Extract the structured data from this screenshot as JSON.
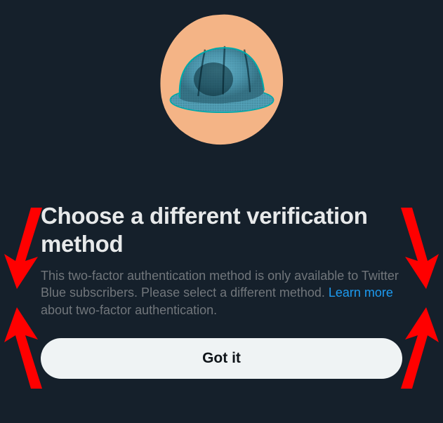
{
  "title": "Choose a different verification method",
  "body_prefix": "This two-factor authentication method is only available to Twitter Blue subscribers. Please select a different method. ",
  "link_text": "Learn more",
  "body_suffix": " about two-factor authentication.",
  "button_label": "Got it",
  "colors": {
    "background": "#15202b",
    "text_primary": "#e7e9ea",
    "text_secondary": "#71767b",
    "link": "#1d9bf0",
    "button_bg": "#eff3f4",
    "button_text": "#0f1419",
    "blob": "#f4b486",
    "annotation_arrow": "#ff0000"
  }
}
